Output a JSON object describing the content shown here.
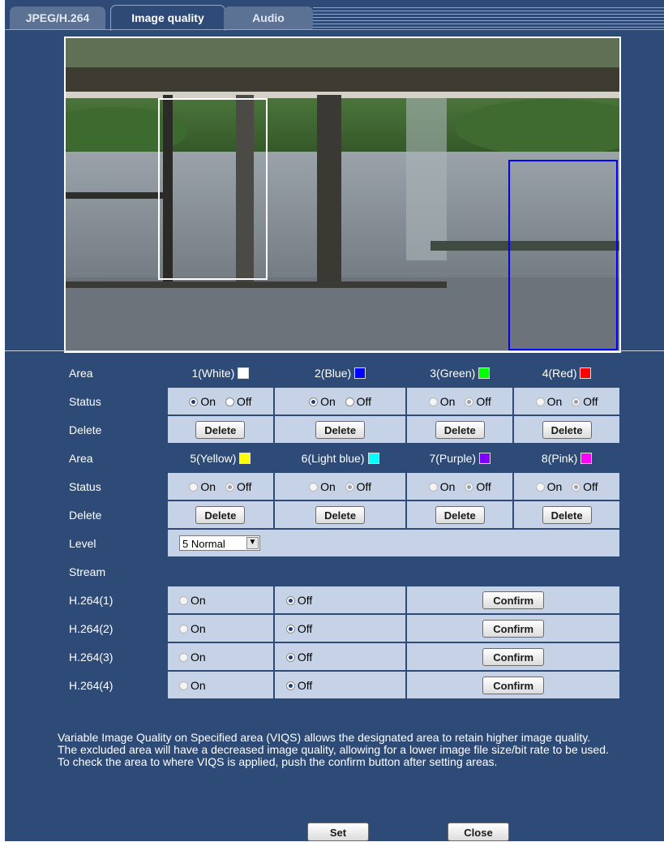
{
  "tabs": [
    {
      "label": "JPEG/H.264",
      "active": false
    },
    {
      "label": "Image quality",
      "active": true
    },
    {
      "label": "Audio",
      "active": false
    }
  ],
  "area_rows": [
    {
      "header_label": "Area",
      "areas": [
        {
          "label": "1(White)",
          "color": "#ffffff"
        },
        {
          "label": "2(Blue)",
          "color": "#0000ff"
        },
        {
          "label": "3(Green)",
          "color": "#00ff00"
        },
        {
          "label": "4(Red)",
          "color": "#ff0000"
        }
      ],
      "status": [
        "On",
        "On",
        "Off",
        "Off"
      ]
    },
    {
      "header_label": "Area",
      "areas": [
        {
          "label": "5(Yellow)",
          "color": "#ffff00"
        },
        {
          "label": "6(Light blue)",
          "color": "#00ffff"
        },
        {
          "label": "7(Purple)",
          "color": "#8000ff"
        },
        {
          "label": "8(Pink)",
          "color": "#ff00ff"
        }
      ],
      "status": [
        "Off",
        "Off",
        "Off",
        "Off"
      ]
    }
  ],
  "labels": {
    "status": "Status",
    "delete": "Delete",
    "level": "Level",
    "stream": "Stream",
    "on": "On",
    "off": "Off",
    "delete_button": "Delete",
    "confirm_button": "Confirm"
  },
  "level": {
    "selected": "5 Normal"
  },
  "streams": [
    {
      "label": "H.264(1)",
      "value": "Off"
    },
    {
      "label": "H.264(2)",
      "value": "Off"
    },
    {
      "label": "H.264(3)",
      "value": "Off"
    },
    {
      "label": "H.264(4)",
      "value": "Off"
    }
  ],
  "description": [
    "Variable Image Quality on Specified area (VIQS) allows the designated area to retain higher image quality.",
    "The excluded area will have a decreased image quality, allowing for a lower image file size/bit rate to be used.",
    "To check the area to where VIQS is applied, push the confirm button after setting areas."
  ],
  "buttons": {
    "set": "Set",
    "close": "Close"
  },
  "camera_regions": [
    {
      "area": "1(White)",
      "color": "#ffffff"
    },
    {
      "area": "2(Blue)",
      "color": "#0000ff"
    }
  ]
}
